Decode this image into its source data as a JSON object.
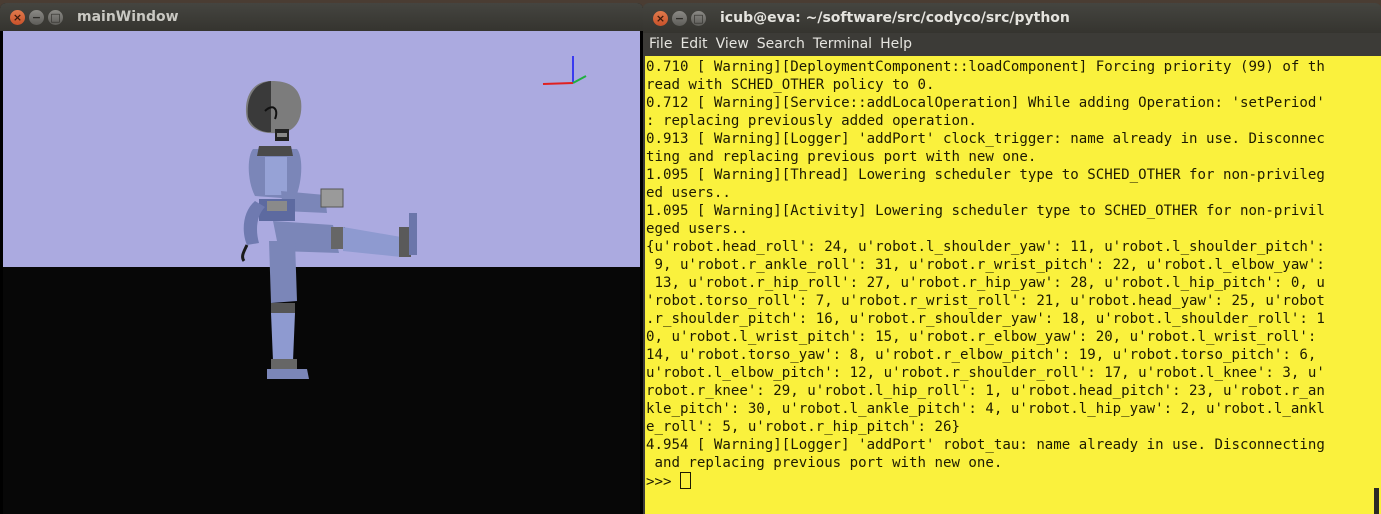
{
  "left_window": {
    "title": "mainWindow",
    "controls": {
      "close": "×",
      "minimize": "−",
      "maximize": "□"
    },
    "colors": {
      "sky": "#abaae0",
      "ground": "#070707"
    }
  },
  "terminal": {
    "title": "icub@eva: ~/software/src/codyco/src/python",
    "controls": {
      "close": "×",
      "minimize": "−",
      "maximize": "□"
    },
    "menu": [
      "File",
      "Edit",
      "View",
      "Search",
      "Terminal",
      "Help"
    ],
    "background_color": "#faf13d",
    "lines": [
      "0.710 [ Warning][DeploymentComponent::loadComponent] Forcing priority (99) of th",
      "read with SCHED_OTHER policy to 0.",
      "0.712 [ Warning][Service::addLocalOperation] While adding Operation: 'setPeriod'",
      ": replacing previously added operation.",
      "0.913 [ Warning][Logger] 'addPort' clock_trigger: name already in use. Disconnec",
      "ting and replacing previous port with new one.",
      "1.095 [ Warning][Thread] Lowering scheduler type to SCHED_OTHER for non-privileg",
      "ed users..",
      "1.095 [ Warning][Activity] Lowering scheduler type to SCHED_OTHER for non-privil",
      "eged users..",
      "{u'robot.head_roll': 24, u'robot.l_shoulder_yaw': 11, u'robot.l_shoulder_pitch':",
      " 9, u'robot.r_ankle_roll': 31, u'robot.r_wrist_pitch': 22, u'robot.l_elbow_yaw':",
      " 13, u'robot.r_hip_roll': 27, u'robot.r_hip_yaw': 28, u'robot.l_hip_pitch': 0, u",
      "'robot.torso_roll': 7, u'robot.r_wrist_roll': 21, u'robot.head_yaw': 25, u'robot",
      ".r_shoulder_pitch': 16, u'robot.r_shoulder_yaw': 18, u'robot.l_shoulder_roll': 1",
      "0, u'robot.l_wrist_pitch': 15, u'robot.r_elbow_yaw': 20, u'robot.l_wrist_roll':",
      "14, u'robot.torso_yaw': 8, u'robot.r_elbow_pitch': 19, u'robot.torso_pitch': 6,",
      "u'robot.l_elbow_pitch': 12, u'robot.r_shoulder_roll': 17, u'robot.l_knee': 3, u'",
      "robot.r_knee': 29, u'robot.l_hip_roll': 1, u'robot.head_pitch': 23, u'robot.r_an",
      "kle_pitch': 30, u'robot.l_ankle_pitch': 4, u'robot.l_hip_yaw': 2, u'robot.l_ankl",
      "e_roll': 5, u'robot.r_hip_pitch': 26}",
      "4.954 [ Warning][Logger] 'addPort' robot_tau: name already in use. Disconnecting",
      " and replacing previous port with new one."
    ],
    "prompt": ">>> "
  }
}
